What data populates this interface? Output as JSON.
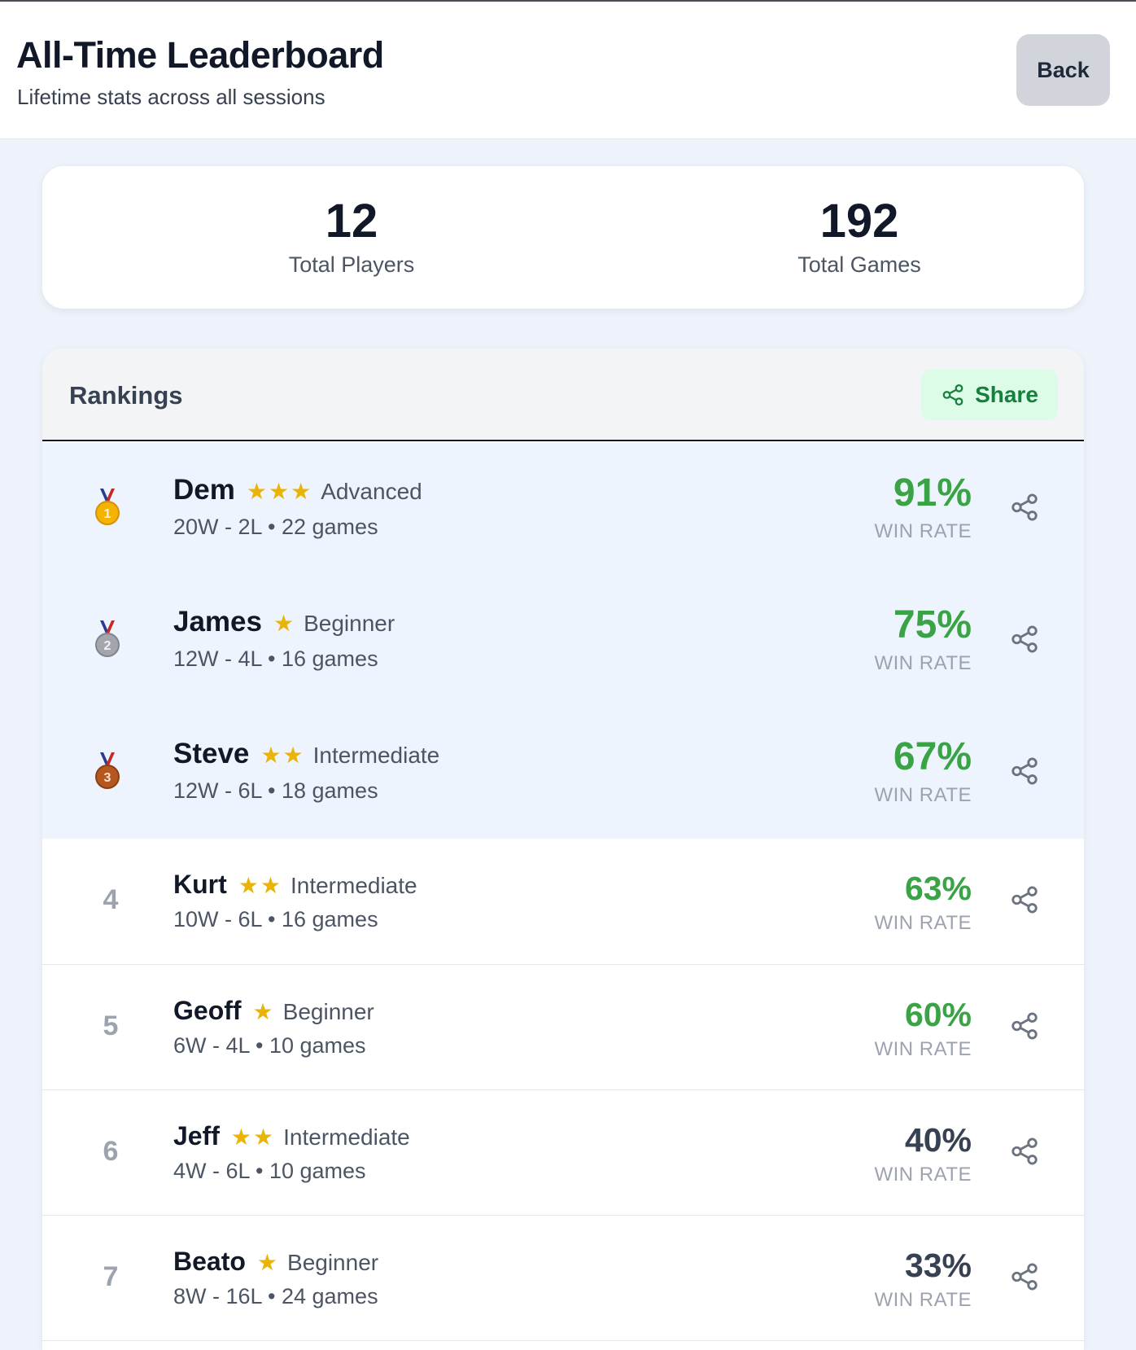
{
  "header": {
    "title": "All-Time Leaderboard",
    "subtitle": "Lifetime stats across all sessions",
    "back_label": "Back"
  },
  "stats": {
    "players_value": "12",
    "players_label": "Total Players",
    "games_value": "192",
    "games_label": "Total Games"
  },
  "rankings": {
    "title": "Rankings",
    "share_label": "Share",
    "share_icon": "share-icon",
    "rows": [
      {
        "rank": "1",
        "medal": "gold-medal-icon",
        "name": "Dem",
        "stars": "★★★",
        "level": "Advanced",
        "record": "20W - 2L • 22 games",
        "rate": "91%",
        "rate_label": "WIN RATE"
      },
      {
        "rank": "2",
        "medal": "silver-medal-icon",
        "name": "James",
        "stars": "★",
        "level": "Beginner",
        "record": "12W - 4L • 16 games",
        "rate": "75%",
        "rate_label": "WIN RATE"
      },
      {
        "rank": "3",
        "medal": "bronze-medal-icon",
        "name": "Steve",
        "stars": "★★",
        "level": "Intermediate",
        "record": "12W - 6L • 18 games",
        "rate": "67%",
        "rate_label": "WIN RATE"
      },
      {
        "rank": "4",
        "name": "Kurt",
        "stars": "★★",
        "level": "Intermediate",
        "record": "10W - 6L • 16 games",
        "rate": "63%",
        "rate_label": "WIN RATE"
      },
      {
        "rank": "5",
        "name": "Geoff",
        "stars": "★",
        "level": "Beginner",
        "record": "6W - 4L • 10 games",
        "rate": "60%",
        "rate_label": "WIN RATE"
      },
      {
        "rank": "6",
        "name": "Jeff",
        "stars": "★★",
        "level": "Intermediate",
        "record": "4W - 6L • 10 games",
        "rate": "40%",
        "rate_label": "WIN RATE"
      },
      {
        "rank": "7",
        "name": "Beato",
        "stars": "★",
        "level": "Beginner",
        "record": "8W - 16L • 24 games",
        "rate": "33%",
        "rate_label": "WIN RATE"
      }
    ]
  },
  "colors": {
    "accent_green": "#3aa346",
    "share_green": "#15803d",
    "star_gold": "#eab308",
    "top_row_bg": "#eef4fd"
  }
}
